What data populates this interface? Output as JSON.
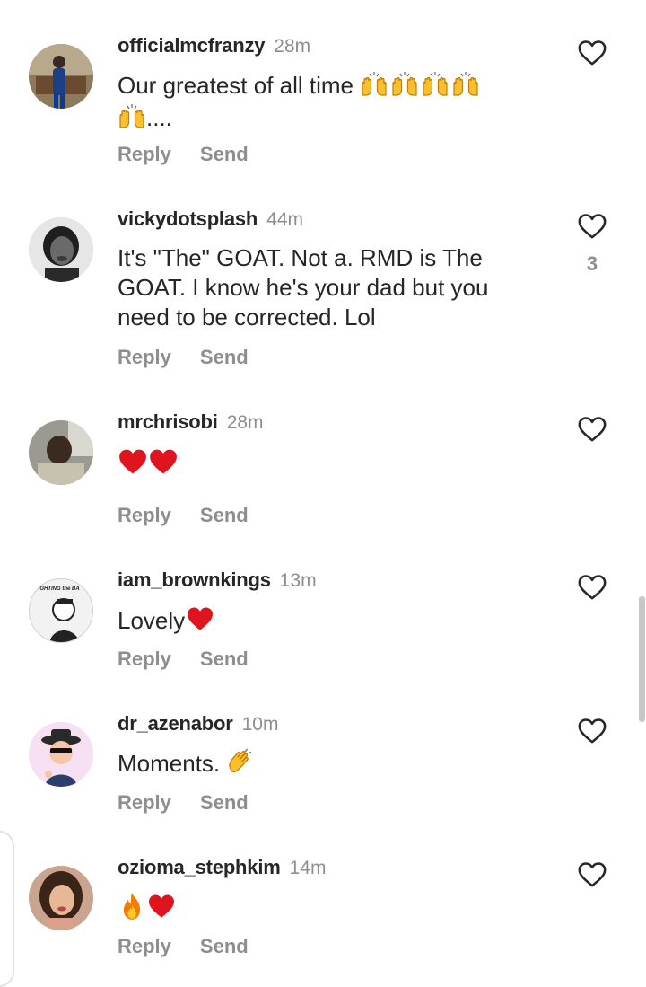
{
  "actions": {
    "reply": "Reply",
    "send": "Send"
  },
  "comments": [
    {
      "username": "officialmcfranzy",
      "time": "28m",
      "text": "Our greatest of all time",
      "text2": "....",
      "likes": ""
    },
    {
      "username": "vickydotsplash",
      "time": "44m",
      "text": "It's \"The\" GOAT.  Not a. RMD is The GOAT. I know he's your dad but you need to be corrected. Lol",
      "likes": "3"
    },
    {
      "username": "mrchrisobi",
      "time": "28m",
      "text": "",
      "likes": ""
    },
    {
      "username": "iam_brownkings",
      "time": "13m",
      "text": "Lovely",
      "avatar_text": "FIGHTING the BA",
      "likes": ""
    },
    {
      "username": "dr_azenabor",
      "time": "10m",
      "text": "Moments.",
      "likes": ""
    },
    {
      "username": "ozioma_stephkim",
      "time": "14m",
      "text": "",
      "likes": ""
    }
  ],
  "icons": {
    "heart": "heart-outline-icon",
    "red_heart": "red-heart-emoji",
    "raised_hands": "raised-hands-emoji",
    "clap": "clapping-hands-emoji",
    "fire": "fire-emoji"
  },
  "colors": {
    "text": "#262626",
    "muted": "#8e8e8e",
    "red_heart": "#e0141e"
  }
}
